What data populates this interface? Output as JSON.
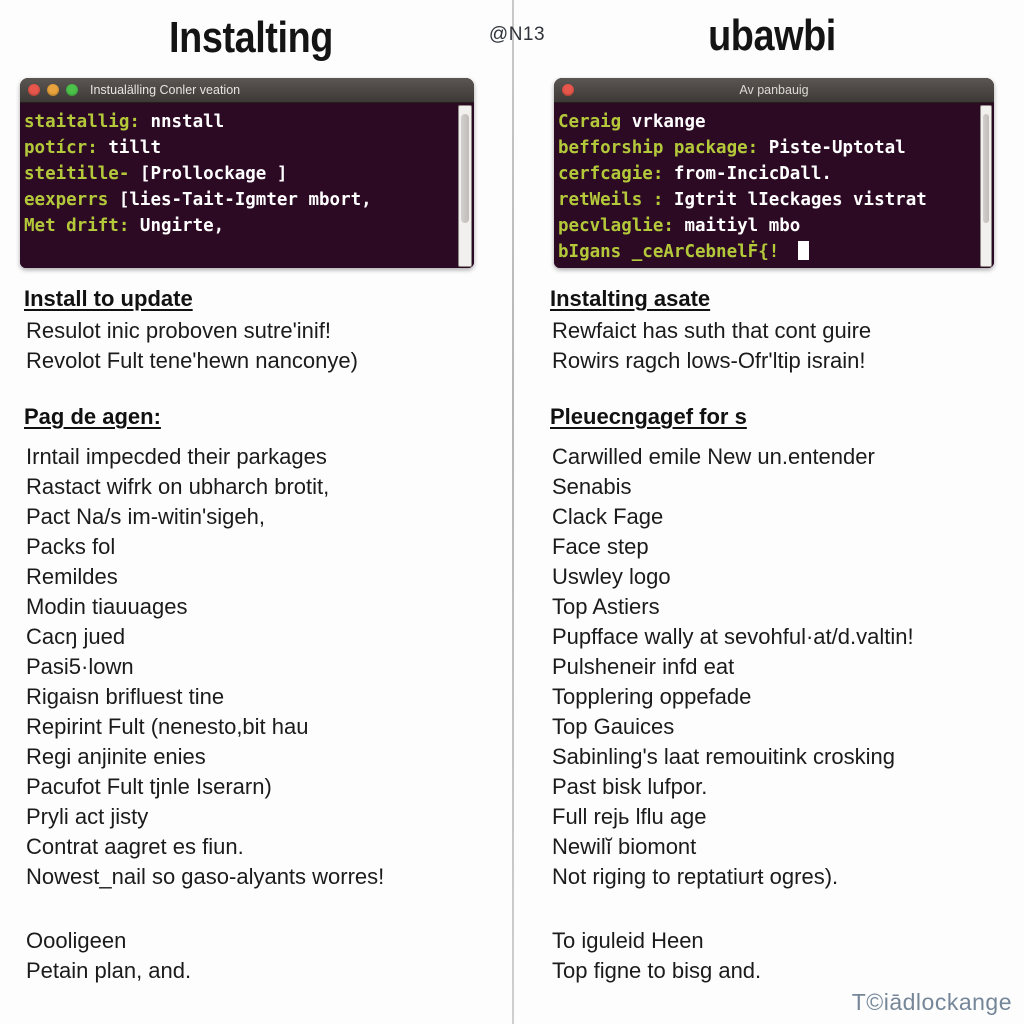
{
  "center_mark": "@N13",
  "brand_watermark": "T©iādlockange",
  "left": {
    "title": "Instalting",
    "terminal": {
      "window_title": "Instualälling Conler veation",
      "buttons": [
        "close-red",
        "minimize-yellow",
        "maximize-green"
      ],
      "lines": [
        {
          "prompt": "staitallig:",
          "command": "nnstall"
        },
        {
          "prompt": "potícr:",
          "command": "tillt"
        },
        {
          "prompt": "steitille-",
          "command": "[Prollockage ]"
        },
        {
          "prompt": "eexperrs",
          "command": "[lies-Tait-Igmter mbort,"
        },
        {
          "prompt": "Met drift:",
          "command": "Ungirte,"
        }
      ]
    },
    "heading_1": "Install to update",
    "paragraph_1": [
      "Resulot inic proboven sutre'inif!",
      "Revolot Fult tene'hewn nanconye)"
    ],
    "heading_2": "Pag de agen:",
    "list": [
      "Irntail impecded their parkages",
      "Rastact wifrk on ubharch brotit,",
      "Pact Na/s im-witin'sigeh,",
      "Packs fol",
      "Remildes",
      "Modin tiauuages",
      "Cacŋ jued",
      "Pasi5·lown",
      "Rigaisn brifluest tine",
      "Repirint Fult (nenesto,bit hau",
      "Regi anjinite enies",
      "Pacufot Fult tjnle Iserarn)",
      "Pryli act jisty",
      "Contrat aagret es fiun.",
      "Nowest_nail so gaso-alyants worres!"
    ],
    "closing": [
      "Oooligeen",
      "Petain plan, and."
    ]
  },
  "right": {
    "title": "ubawbi",
    "terminal": {
      "window_title": "Av panbauig",
      "buttons": [
        "close-red"
      ],
      "lines": [
        {
          "prompt": "Ceraig",
          "command": "vrkange"
        },
        {
          "prompt": "befforship package:",
          "command": "Piste-Uptotal"
        },
        {
          "prompt": "cerfcagie:",
          "command": "from-IncicDall."
        },
        {
          "prompt": "retWeils :",
          "command": "Igtrit lIeckages vistrat"
        },
        {
          "prompt": "pecvlaglie:",
          "command": "maitiyl mbo"
        },
        {
          "prompt": "bIgans",
          "command": "_ceArCebnelḞ{!",
          "cursor": true
        }
      ]
    },
    "heading_1": "Instalting asate",
    "paragraph_1": [
      "Rewfaict has suth that cont guire",
      "Rowirs ragch lows-Ofr'ltip israin!"
    ],
    "heading_2": "Pleuecngagef for s",
    "list": [
      "Carwilled emile New un.entender",
      "Senabis",
      "Clack Fage",
      "Face step",
      "Uswley logo",
      "Top Astiers",
      "Pupfface wally at sevohful·at/d.valtin!",
      "Pulsheneir infd eat",
      "Topplering oppefade",
      "Top Gauices",
      "Sabinling's laat remouitink crosking",
      "Past bisk lufpor.",
      "Full rejь lflu age",
      "Newilĭ biomont",
      "Not riging to reptatiurŧ ogres)."
    ],
    "closing": [
      "To iguleid Heen",
      "Top figne to bisg and."
    ]
  },
  "colors": {
    "terminal_bg": "#2d0a24",
    "terminal_prompt": "#b3c93a",
    "terminal_text": "#ffffff",
    "titlebar": "#4a4541",
    "watermark": "#5d7287"
  }
}
